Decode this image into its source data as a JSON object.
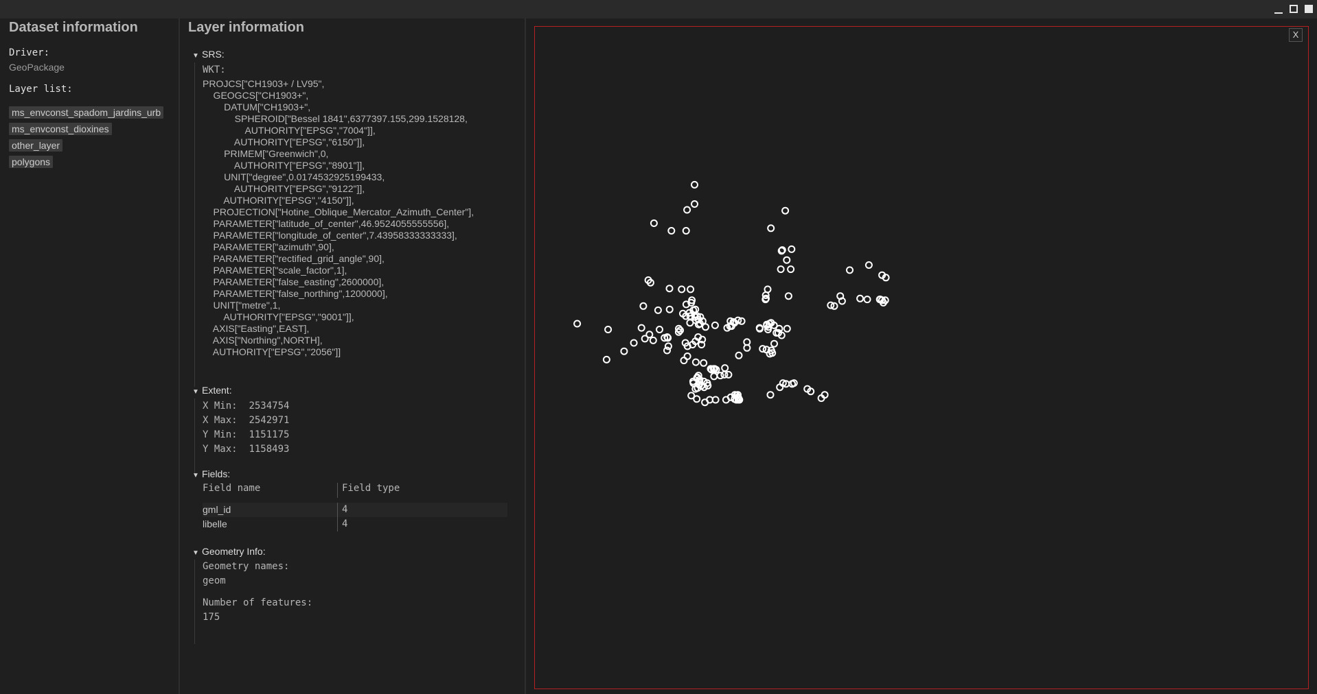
{
  "dataset": {
    "title": "Dataset information",
    "driver_label": "Driver:",
    "driver_value": "GeoPackage",
    "layer_list_label": "Layer list:",
    "layers": [
      "ms_envconst_spadom_jardins_urb",
      "ms_envconst_dioxines",
      "other_layer",
      "polygons"
    ]
  },
  "layer": {
    "title": "Layer information",
    "srs_label": "SRS:",
    "wkt_label": "WKT:",
    "wkt_lines": [
      "PROJCS[\"CH1903+ / LV95\",",
      "    GEOGCS[\"CH1903+\",",
      "        DATUM[\"CH1903+\",",
      "            SPHEROID[\"Bessel 1841\",6377397.155,299.1528128,",
      "                AUTHORITY[\"EPSG\",\"7004\"]],",
      "            AUTHORITY[\"EPSG\",\"6150\"]],",
      "        PRIMEM[\"Greenwich\",0,",
      "            AUTHORITY[\"EPSG\",\"8901\"]],",
      "        UNIT[\"degree\",0.0174532925199433,",
      "            AUTHORITY[\"EPSG\",\"9122\"]],",
      "        AUTHORITY[\"EPSG\",\"4150\"]],",
      "    PROJECTION[\"Hotine_Oblique_Mercator_Azimuth_Center\"],",
      "    PARAMETER[\"latitude_of_center\",46.9524055555556],",
      "    PARAMETER[\"longitude_of_center\",7.43958333333333],",
      "    PARAMETER[\"azimuth\",90],",
      "    PARAMETER[\"rectified_grid_angle\",90],",
      "    PARAMETER[\"scale_factor\",1],",
      "    PARAMETER[\"false_easting\",2600000],",
      "    PARAMETER[\"false_northing\",1200000],",
      "    UNIT[\"metre\",1,",
      "        AUTHORITY[\"EPSG\",\"9001\"]],",
      "    AXIS[\"Easting\",EAST],",
      "    AXIS[\"Northing\",NORTH],",
      "    AUTHORITY[\"EPSG\",\"2056\"]]"
    ],
    "extent_label": "Extent:",
    "extent": {
      "xmin_label": "X Min:",
      "xmin": "2534754",
      "xmax_label": "X Max:",
      "xmax": "2542971",
      "ymin_label": "Y Min:",
      "ymin": "1151175",
      "ymax_label": "Y Max:",
      "ymax": "1158493"
    },
    "fields_label": "Fields:",
    "fields_header": [
      "Field name",
      "Field type"
    ],
    "fields": [
      {
        "name": "gml_id",
        "type": "4"
      },
      {
        "name": "libelle",
        "type": "4"
      }
    ],
    "geometry_label": "Geometry Info:",
    "geometry_names_label": "Geometry names:",
    "geometry_names": "geom",
    "num_features_label": "Number of features:",
    "num_features": "175"
  },
  "map": {
    "close_label": "X",
    "border_color": "#b52020",
    "point_color": "#ffffff",
    "points": [
      [
        2536154,
        1156900
      ],
      [
        2536154,
        1156670
      ],
      [
        2536065,
        1156600
      ],
      [
        2535670,
        1156440
      ],
      [
        2535878,
        1156350
      ],
      [
        2536053,
        1156350
      ],
      [
        2537237,
        1156590
      ],
      [
        2537065,
        1156380
      ],
      [
        2537312,
        1156130
      ],
      [
        2537201,
        1156120
      ],
      [
        2537192,
        1156110
      ],
      [
        2537255,
        1156000
      ],
      [
        2538235,
        1155940
      ],
      [
        2538392,
        1155820
      ],
      [
        2538437,
        1155790
      ],
      [
        2537183,
        1155890
      ],
      [
        2537302,
        1155890
      ],
      [
        2538006,
        1155880
      ],
      [
        2535629,
        1155730
      ],
      [
        2535602,
        1155760
      ],
      [
        2535855,
        1155660
      ],
      [
        2537027,
        1155650
      ],
      [
        2536000,
        1155650
      ],
      [
        2536106,
        1155650
      ],
      [
        2537276,
        1155570
      ],
      [
        2537893,
        1155570
      ],
      [
        2538130,
        1155540
      ],
      [
        2538215,
        1155530
      ],
      [
        2538364,
        1155530
      ],
      [
        2538371,
        1155530
      ],
      [
        2538391,
        1155520
      ],
      [
        2538430,
        1155520
      ],
      [
        2538407,
        1155490
      ],
      [
        2537004,
        1155580
      ],
      [
        2537006,
        1155540
      ],
      [
        2537001,
        1155530
      ],
      [
        2537822,
        1155450
      ],
      [
        2537915,
        1155510
      ],
      [
        2537779,
        1155460
      ],
      [
        2536122,
        1155520
      ],
      [
        2536115,
        1155490
      ],
      [
        2535543,
        1155450
      ],
      [
        2535719,
        1155400
      ],
      [
        2535857,
        1155410
      ],
      [
        2536164,
        1155410
      ],
      [
        2536055,
        1155470
      ],
      [
        2536140,
        1155400
      ],
      [
        2536093,
        1155370
      ],
      [
        2536015,
        1155360
      ],
      [
        2536050,
        1155330
      ],
      [
        2536102,
        1155330
      ],
      [
        2536161,
        1155320
      ],
      [
        2536186,
        1155330
      ],
      [
        2536223,
        1155320
      ],
      [
        2536200,
        1155290
      ],
      [
        2536170,
        1155280
      ],
      [
        2536252,
        1155270
      ],
      [
        2536100,
        1155250
      ],
      [
        2536220,
        1155240
      ],
      [
        2536203,
        1155230
      ],
      [
        2536285,
        1155200
      ],
      [
        2536399,
        1155220
      ],
      [
        2536596,
        1155210
      ],
      [
        2536543,
        1155190
      ],
      [
        2536577,
        1155210
      ],
      [
        2537016,
        1155230
      ],
      [
        2537102,
        1155220
      ],
      [
        2537036,
        1155200
      ],
      [
        2537016,
        1155220
      ],
      [
        2536930,
        1155190
      ],
      [
        2536933,
        1155180
      ],
      [
        2537031,
        1155170
      ],
      [
        2536716,
        1155270
      ],
      [
        2536673,
        1155280
      ],
      [
        2536630,
        1155250
      ],
      [
        2536582,
        1155270
      ],
      [
        2536618,
        1155260
      ],
      [
        2537067,
        1155250
      ],
      [
        2537047,
        1155240
      ],
      [
        2537165,
        1155180
      ],
      [
        2537259,
        1155180
      ],
      [
        2537154,
        1155130
      ],
      [
        2537131,
        1155130
      ],
      [
        2537193,
        1155100
      ],
      [
        2534754,
        1155240
      ],
      [
        2535122,
        1155170
      ],
      [
        2535521,
        1155190
      ],
      [
        2535736,
        1155170
      ],
      [
        2535966,
        1155180
      ],
      [
        2535982,
        1155160
      ],
      [
        2535965,
        1155140
      ],
      [
        2535828,
        1155080
      ],
      [
        2535835,
        1155070
      ],
      [
        2535795,
        1155070
      ],
      [
        2536197,
        1155080
      ],
      [
        2536246,
        1155050
      ],
      [
        2536165,
        1155030
      ],
      [
        2536045,
        1155010
      ],
      [
        2536237,
        1154990
      ],
      [
        2536130,
        1154990
      ],
      [
        2536070,
        1154970
      ],
      [
        2535842,
        1154970
      ],
      [
        2537105,
        1155000
      ],
      [
        2536967,
        1154940
      ],
      [
        2537012,
        1154930
      ],
      [
        2537070,
        1154920
      ],
      [
        2537052,
        1154880
      ],
      [
        2537082,
        1154890
      ],
      [
        2536779,
        1155020
      ],
      [
        2536780,
        1154950
      ],
      [
        2536683,
        1154860
      ],
      [
        2535826,
        1154920
      ],
      [
        2535661,
        1155040
      ],
      [
        2535616,
        1155110
      ],
      [
        2535562,
        1155060
      ],
      [
        2535430,
        1155010
      ],
      [
        2535313,
        1154910
      ],
      [
        2535104,
        1154810
      ],
      [
        2536027,
        1154800
      ],
      [
        2536069,
        1154850
      ],
      [
        2536170,
        1154780
      ],
      [
        2536262,
        1154770
      ],
      [
        2536347,
        1154700
      ],
      [
        2536412,
        1154690
      ],
      [
        2536380,
        1154700
      ],
      [
        2536358,
        1154690
      ],
      [
        2536393,
        1154700
      ],
      [
        2536516,
        1154710
      ],
      [
        2536559,
        1154630
      ],
      [
        2536510,
        1154630
      ],
      [
        2536462,
        1154620
      ],
      [
        2536386,
        1154610
      ],
      [
        2536201,
        1154620
      ],
      [
        2536183,
        1154590
      ],
      [
        2536187,
        1154600
      ],
      [
        2536215,
        1154570
      ],
      [
        2536265,
        1154550
      ],
      [
        2536213,
        1154550
      ],
      [
        2536137,
        1154550
      ],
      [
        2536140,
        1154530
      ],
      [
        2536210,
        1154510
      ],
      [
        2536237,
        1154500
      ],
      [
        2536305,
        1154530
      ],
      [
        2536312,
        1154500
      ],
      [
        2536268,
        1154480
      ],
      [
        2536190,
        1154470
      ],
      [
        2536165,
        1154460
      ],
      [
        2536115,
        1154380
      ],
      [
        2536180,
        1154340
      ],
      [
        2536278,
        1154300
      ],
      [
        2536335,
        1154330
      ],
      [
        2536405,
        1154330
      ],
      [
        2536530,
        1154330
      ],
      [
        2536587,
        1154360
      ],
      [
        2536636,
        1154390
      ],
      [
        2536654,
        1154380
      ],
      [
        2536670,
        1154390
      ],
      [
        2536632,
        1154340
      ],
      [
        2536652,
        1154330
      ],
      [
        2536676,
        1154330
      ],
      [
        2536672,
        1154360
      ],
      [
        2536679,
        1154350
      ],
      [
        2536689,
        1154330
      ],
      [
        2537060,
        1154390
      ],
      [
        2537172,
        1154480
      ],
      [
        2537210,
        1154530
      ],
      [
        2537246,
        1154520
      ],
      [
        2537319,
        1154520
      ],
      [
        2537341,
        1154530
      ],
      [
        2537500,
        1154460
      ],
      [
        2537541,
        1154430
      ],
      [
        2537667,
        1154350
      ],
      [
        2537708,
        1154390
      ]
    ]
  }
}
